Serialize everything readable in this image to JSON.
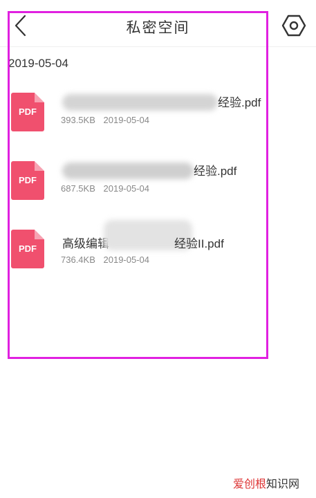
{
  "header": {
    "title": "私密空间",
    "back_icon": "chevron-left-icon",
    "settings_icon": "hexagon-settings-icon"
  },
  "date_header": "2019-05-04",
  "files": [
    {
      "icon_label": "PDF",
      "name_suffix": "经验.pdf",
      "size": "393.5KB",
      "date": "2019-05-04"
    },
    {
      "icon_label": "PDF",
      "name_suffix": "经验.pdf",
      "size": "687.5KB",
      "date": "2019-05-04"
    },
    {
      "icon_label": "PDF",
      "name_prefix": "高级编辑",
      "name_suffix": "经验II.pdf",
      "size": "736.4KB",
      "date": "2019-05-04"
    }
  ],
  "watermark": {
    "accent": "爱创根",
    "rest": "知识网"
  },
  "colors": {
    "pdf_icon": "#f0506e",
    "highlight_frame": "#e020e0"
  }
}
